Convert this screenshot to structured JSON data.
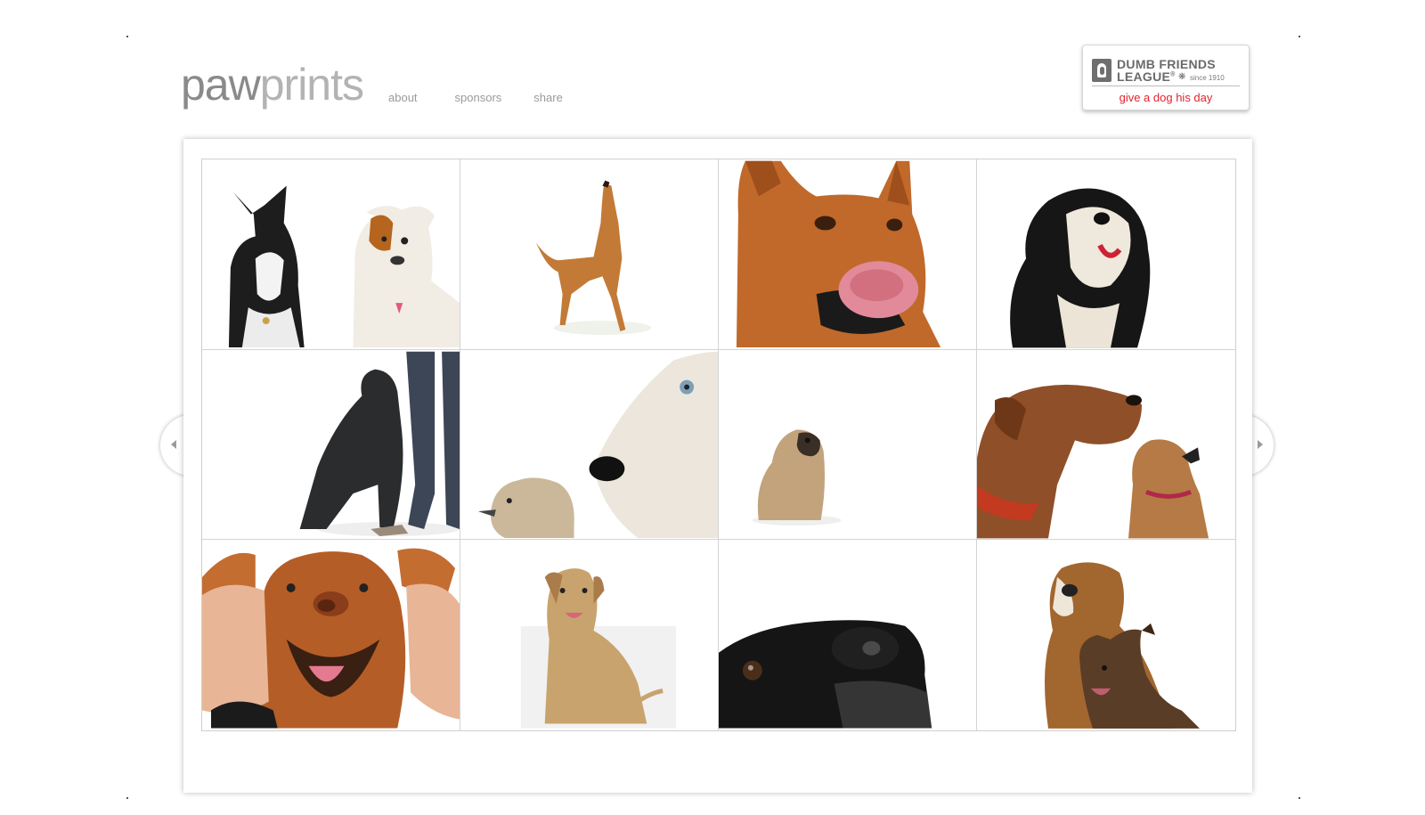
{
  "header": {
    "logo_bold": "paw",
    "logo_light": "prints",
    "nav": [
      {
        "label": "about"
      },
      {
        "label": "sponsors"
      },
      {
        "label": "share"
      }
    ]
  },
  "badge": {
    "org_line1": "DUMB FRIENDS",
    "org_line2": "LEAGUE",
    "trademark": "®",
    "since": "since 1910",
    "tagline": "give a dog his day"
  },
  "carousel": {
    "prev_label": "more",
    "next_label": "more"
  },
  "photos": [
    {
      "subject": "two dogs, black-white and white-brown"
    },
    {
      "subject": "tan dog howling upward"
    },
    {
      "subject": "red dog licking nose"
    },
    {
      "subject": "black and white shih tzu looking up"
    },
    {
      "subject": "black dog leaning on person's legs"
    },
    {
      "subject": "white scruffy dog close-up with small dog"
    },
    {
      "subject": "small fawn pug sitting"
    },
    {
      "subject": "brown dog and small dog with collars"
    },
    {
      "subject": "smiling brown pit bull held by hands"
    },
    {
      "subject": "yellow labrador sitting"
    },
    {
      "subject": "black dog nose close-up"
    },
    {
      "subject": "two bulldogs"
    }
  ],
  "colors": {
    "tagline_red": "#e0242f",
    "logo_gray": "#8a8a8a",
    "nav_gray": "#9a9a9a"
  }
}
